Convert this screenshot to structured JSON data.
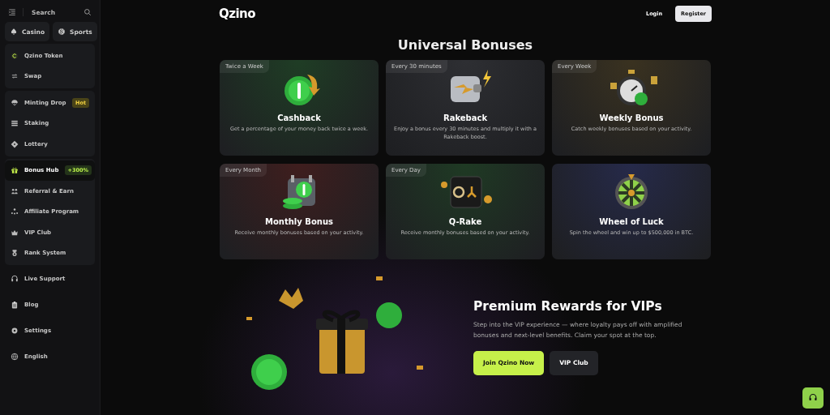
{
  "sidebar": {
    "search_label": "Search",
    "top_tabs": [
      {
        "label": "Casino"
      },
      {
        "label": "Sports"
      }
    ],
    "groups": [
      [
        {
          "label": "Qzino Token",
          "selected": false
        },
        {
          "label": "Swap",
          "selected": false
        }
      ],
      [
        {
          "label": "Minting Drop",
          "selected": false,
          "badge": "Hot"
        },
        {
          "label": "Staking",
          "selected": false
        },
        {
          "label": "Lottery",
          "selected": false
        }
      ],
      [
        {
          "label": "Bonus Hub",
          "selected": true,
          "badge": "+300%"
        },
        {
          "label": "Referral & Earn",
          "selected": false
        },
        {
          "label": "Affiliate Program",
          "selected": false
        },
        {
          "label": "VIP Club",
          "selected": false
        },
        {
          "label": "Rank System",
          "selected": false
        }
      ]
    ],
    "footer_items": [
      {
        "label": "Live Support",
        "selected": false
      },
      {
        "label": "Blog",
        "selected": false
      },
      {
        "label": "Settings",
        "selected": false
      },
      {
        "label": "English",
        "selected": false
      }
    ]
  },
  "header": {
    "logo": "Qzino",
    "login": "Login",
    "register": "Register"
  },
  "bonuses": {
    "title": "Universal Bonuses",
    "cards": [
      {
        "tag": "Twice a Week",
        "title": "Cashback",
        "text": "Get a percentage of your money back twice a week.",
        "kind": "coin",
        "color": "#1f3d25"
      },
      {
        "tag": "Every 30 minutes",
        "title": "Rakeback",
        "text": "Enjoy a bonus every 30 minutes and multiply it with a Rakeback boost.",
        "kind": "wallet",
        "color": "#2e2f33"
      },
      {
        "tag": "Every Week",
        "title": "Weekly Bonus",
        "text": "Catch weekly bonuses based on your activity.",
        "kind": "stopwatch",
        "color": "#3a3220"
      },
      {
        "tag": "Every Month",
        "title": "Monthly Bonus",
        "text": "Receive monthly bonuses based on your activity.",
        "kind": "calendar",
        "color": "#3f1e1e"
      },
      {
        "tag": "Every Day",
        "title": "Q-Rake",
        "text": "Receive monthly bonuses based on your activity.",
        "kind": "safe",
        "color": "#1f3a24"
      },
      {
        "title": "Wheel of Luck",
        "text": "Spin the wheel and win up to $500,000 in BTC.",
        "kind": "wheel",
        "color": "#262a4a"
      }
    ]
  },
  "vip": {
    "title": "Premium Rewards for VIPs",
    "text": "Step into the VIP experience — where loyalty pays off with amplified bonuses and next-level benefits. Claim your spot at the top.",
    "primary_button": "Join Qzino Now",
    "secondary_button": "VIP Club"
  }
}
